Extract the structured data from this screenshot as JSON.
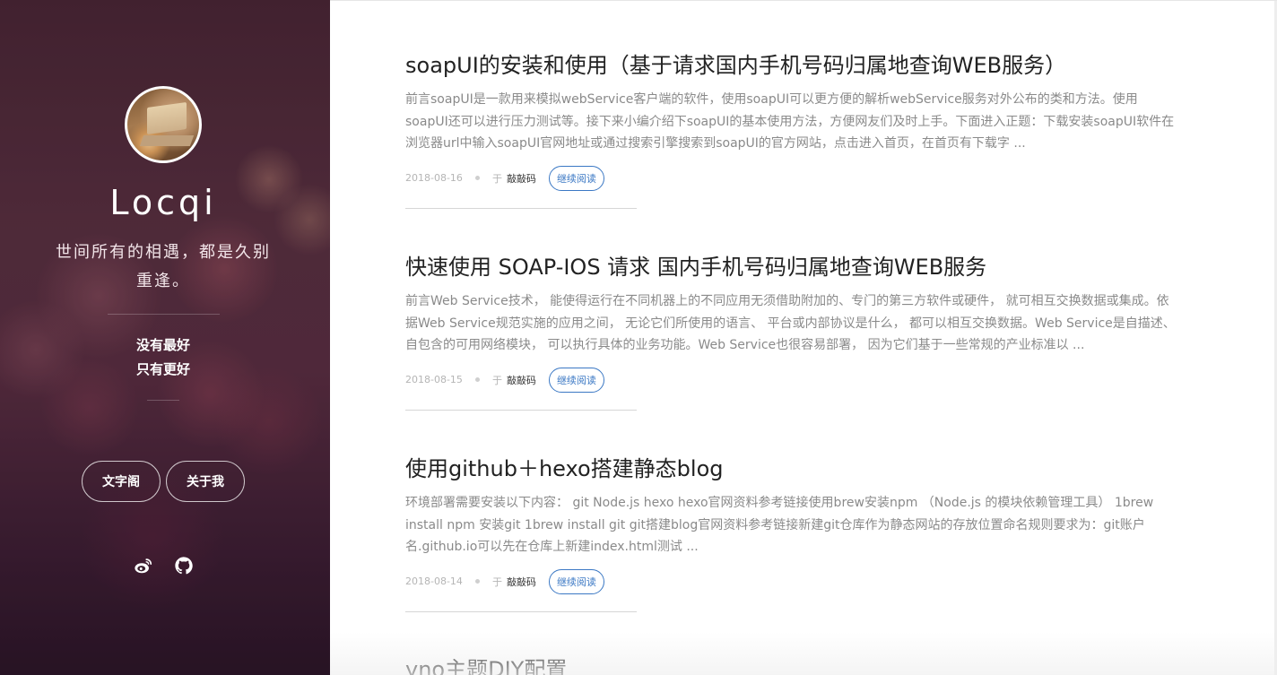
{
  "sidebar": {
    "title": "Locqi",
    "motto": "世间所有的相遇，都是久别重逢。",
    "slogan_line1": "没有最好",
    "slogan_line2": "只有更好",
    "nav": [
      {
        "label": "文字阁"
      },
      {
        "label": "关于我"
      }
    ],
    "social": [
      {
        "icon": "weibo-icon"
      },
      {
        "icon": "github-icon"
      }
    ]
  },
  "posts": [
    {
      "title": "soapUI的安装和使用（基于请求国内手机号码归属地查询WEB服务）",
      "excerpt": "前言soapUI是一款用来模拟webService客户端的软件，使用soapUI可以更方便的解析webService服务对外公布的类和方法。使用soapUI还可以进行压力测试等。接下来小编介绍下soapUI的基本使用方法，方便网友们及时上手。下面进入正题：下载安装soapUI软件在浏览器url中输入soapUI官网地址或通过搜索引擎搜索到soapUI的官方网站，点击进入首页，在首页有下载字 ...",
      "date": "2018-08-16",
      "author_prefix": "于",
      "author": "敲敲码",
      "read_more": "继续阅读"
    },
    {
      "title": "快速使用 SOAP-IOS 请求 国内手机号码归属地查询WEB服务",
      "excerpt": "前言Web Service技术， 能使得运行在不同机器上的不同应用无须借助附加的、专门的第三方软件或硬件， 就可相互交换数据或集成。依据Web Service规范实施的应用之间， 无论它们所使用的语言、 平台或内部协议是什么， 都可以相互交换数据。Web Service是自描述、 自包含的可用网络模块， 可以执行具体的业务功能。Web Service也很容易部署， 因为它们基于一些常规的产业标准以 ...",
      "date": "2018-08-15",
      "author_prefix": "于",
      "author": "敲敲码",
      "read_more": "继续阅读"
    },
    {
      "title": "使用github＋hexo搭建静态blog",
      "excerpt": "环境部署需要安装以下内容： git Node.js hexo hexo官网资料参考链接使用brew安装npm （Node.js 的模块依赖管理工具） 1brew install npm 安装git 1brew install git git搭建blog官网资料参考链接新建git仓库作为静态网站的存放位置命名规则要求为：git账户名.github.io可以先在仓库上新建index.html测试 ...",
      "date": "2018-08-14",
      "author_prefix": "于",
      "author": "敲敲码",
      "read_more": "继续阅读"
    },
    {
      "title": "yno主题DIY配置"
    }
  ],
  "colors": {
    "accent": "#3b78c4",
    "title_text": "#222222",
    "excerpt_text": "#8a8a8a"
  }
}
